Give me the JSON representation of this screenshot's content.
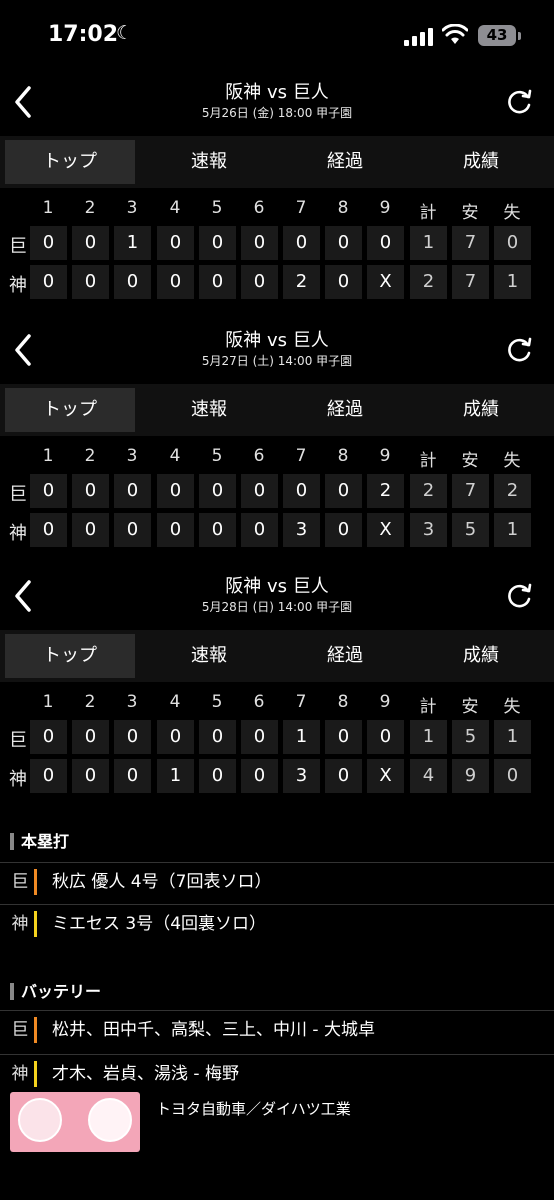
{
  "status_bar": {
    "time": "17:02",
    "battery": "43"
  },
  "tabs": [
    "トップ",
    "速報",
    "経過",
    "成績"
  ],
  "innings": [
    "1",
    "2",
    "3",
    "4",
    "5",
    "6",
    "7",
    "8",
    "9",
    "計",
    "安",
    "失"
  ],
  "games": [
    {
      "title": "阪神 vs 巨人",
      "subtitle": "5月26日 (金) 18:00 甲子園",
      "rows": [
        {
          "team": "巨",
          "cells": [
            "0",
            "0",
            "1",
            "0",
            "0",
            "0",
            "0",
            "0",
            "0",
            "1",
            "7",
            "0"
          ]
        },
        {
          "team": "神",
          "cells": [
            "0",
            "0",
            "0",
            "0",
            "0",
            "0",
            "2",
            "0",
            "X",
            "2",
            "7",
            "1"
          ]
        }
      ]
    },
    {
      "title": "阪神 vs 巨人",
      "subtitle": "5月27日 (土) 14:00 甲子園",
      "rows": [
        {
          "team": "巨",
          "cells": [
            "0",
            "0",
            "0",
            "0",
            "0",
            "0",
            "0",
            "0",
            "2",
            "2",
            "7",
            "2"
          ]
        },
        {
          "team": "神",
          "cells": [
            "0",
            "0",
            "0",
            "0",
            "0",
            "0",
            "3",
            "0",
            "X",
            "3",
            "5",
            "1"
          ]
        }
      ]
    },
    {
      "title": "阪神 vs 巨人",
      "subtitle": "5月28日 (日) 14:00 甲子園",
      "rows": [
        {
          "team": "巨",
          "cells": [
            "0",
            "0",
            "0",
            "0",
            "0",
            "0",
            "1",
            "0",
            "0",
            "1",
            "5",
            "1"
          ]
        },
        {
          "team": "神",
          "cells": [
            "0",
            "0",
            "0",
            "1",
            "0",
            "0",
            "3",
            "0",
            "X",
            "4",
            "9",
            "0"
          ]
        }
      ]
    }
  ],
  "home_runs": {
    "heading": "本塁打",
    "rows": [
      {
        "team": "巨",
        "text": "秋広 優人 4号（7回表ソロ）"
      },
      {
        "team": "神",
        "text": "ミエセス 3号（4回裏ソロ）"
      }
    ]
  },
  "battery": {
    "heading": "バッテリー",
    "rows": [
      {
        "team": "巨",
        "text": "松井、田中千、高梨、三上、中川 - 大城卓"
      },
      {
        "team": "神",
        "text": "才木、岩貞、湯浅 - 梅野"
      }
    ]
  },
  "ad": {
    "text": "トヨタ自動車／ダイハツ工業"
  },
  "colors": {
    "giants": "#f08a24",
    "tigers": "#f5d21e"
  }
}
